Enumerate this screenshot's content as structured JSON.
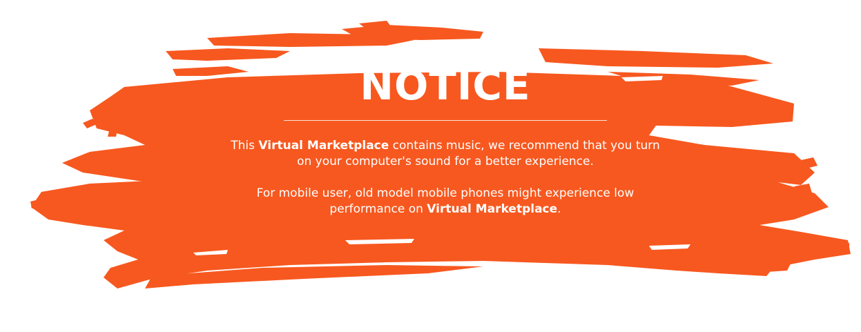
{
  "notice": {
    "title": "NOTICE",
    "paragraph1": {
      "pre": "This ",
      "bold": "Virtual Marketplace",
      "post": " contains music, we recommend that you turn on your computer's sound for a better experience."
    },
    "paragraph2": {
      "pre": "For mobile user, old model mobile phones might experience low performance on ",
      "bold": "Virtual Marketplace",
      "post": "."
    }
  },
  "colors": {
    "brush": "#f7581f",
    "text": "#ffffff",
    "background": "#ffffff"
  },
  "icons": {
    "background": "brush-stroke"
  }
}
